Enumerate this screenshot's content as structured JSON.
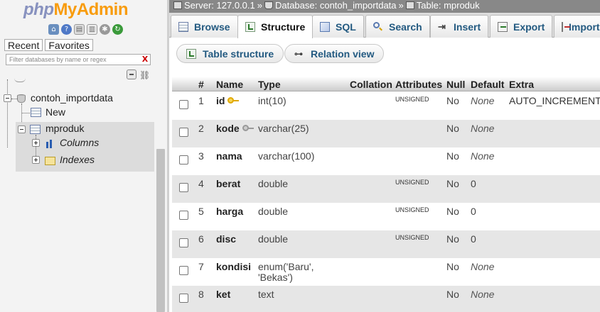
{
  "nav": {
    "logo": {
      "php": "php",
      "my": "My",
      "admin": "Admin"
    },
    "tabs": {
      "recent": "Recent",
      "favorites": "Favorites"
    },
    "filter_placeholder": "Filter databases by name or regex",
    "filter_clear": "X",
    "tree": {
      "database": "contoh_importdata",
      "new": "New",
      "table": "mproduk",
      "columns": "Columns",
      "indexes": "Indexes"
    }
  },
  "breadcrumb": {
    "server": "Server: 127.0.0.1",
    "database": "Database: contoh_importdata",
    "table": "Table: mproduk",
    "separator": "»"
  },
  "tabs": [
    {
      "label": "Browse",
      "icon": "browse-icon"
    },
    {
      "label": "Structure",
      "icon": "structure-icon",
      "active": true
    },
    {
      "label": "SQL",
      "icon": "sql-icon"
    },
    {
      "label": "Search",
      "icon": "search-icon"
    },
    {
      "label": "Insert",
      "icon": "insert-icon"
    },
    {
      "label": "Export",
      "icon": "export-icon"
    },
    {
      "label": "Import",
      "icon": "import-icon"
    }
  ],
  "subtabs": {
    "table_structure": "Table structure",
    "relation_view": "Relation view"
  },
  "table": {
    "headers": {
      "num": "#",
      "name": "Name",
      "type": "Type",
      "collation": "Collation",
      "attributes": "Attributes",
      "null": "Null",
      "default": "Default",
      "extra": "Extra"
    },
    "rows": [
      {
        "num": "1",
        "name": "id",
        "key": "primary",
        "type": "int(10)",
        "type2": "",
        "attributes": "UNSIGNED",
        "null": "No",
        "default": "None",
        "extra": "AUTO_INCREMENT"
      },
      {
        "num": "2",
        "name": "kode",
        "key": "index",
        "type": "varchar(25)",
        "type2": "",
        "attributes": "",
        "null": "No",
        "default": "None",
        "extra": ""
      },
      {
        "num": "3",
        "name": "nama",
        "key": "",
        "type": "varchar(100)",
        "type2": "",
        "attributes": "",
        "null": "No",
        "default": "None",
        "extra": ""
      },
      {
        "num": "4",
        "name": "berat",
        "key": "",
        "type": "double",
        "type2": "",
        "attributes": "UNSIGNED",
        "null": "No",
        "default": "0",
        "extra": ""
      },
      {
        "num": "5",
        "name": "harga",
        "key": "",
        "type": "double",
        "type2": "",
        "attributes": "UNSIGNED",
        "null": "No",
        "default": "0",
        "extra": ""
      },
      {
        "num": "6",
        "name": "disc",
        "key": "",
        "type": "double",
        "type2": "",
        "attributes": "UNSIGNED",
        "null": "No",
        "default": "0",
        "extra": ""
      },
      {
        "num": "7",
        "name": "kondisi",
        "key": "",
        "type": "enum('Baru',",
        "type2": "'Bekas')",
        "attributes": "",
        "null": "No",
        "default": "None",
        "extra": ""
      },
      {
        "num": "8",
        "name": "ket",
        "key": "",
        "type": "text",
        "type2": "",
        "attributes": "",
        "null": "No",
        "default": "None",
        "extra": ""
      }
    ]
  },
  "colors": {
    "link": "#235a81",
    "logo_php": "#8892bf",
    "logo_accent": "#f89c0e",
    "breadcrumb_bg": "#888888"
  }
}
